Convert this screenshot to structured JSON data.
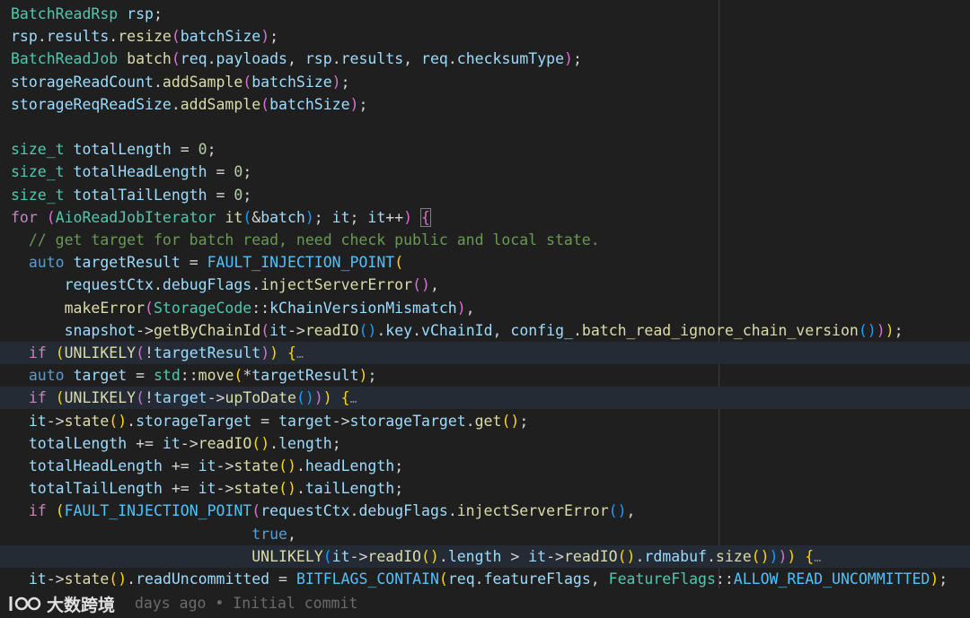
{
  "lines": [
    {
      "hl": false,
      "tokens": [
        {
          "t": "BatchReadRsp",
          "c": "t-type"
        },
        {
          "t": " ",
          "c": "t-plain"
        },
        {
          "t": "rsp",
          "c": "t-var"
        },
        {
          "t": ";",
          "c": "t-op"
        }
      ]
    },
    {
      "hl": false,
      "tokens": [
        {
          "t": "rsp",
          "c": "t-var"
        },
        {
          "t": ".",
          "c": "t-op"
        },
        {
          "t": "results",
          "c": "t-var"
        },
        {
          "t": ".",
          "c": "t-op"
        },
        {
          "t": "resize",
          "c": "t-fn"
        },
        {
          "t": "(",
          "c": "t-p2"
        },
        {
          "t": "batchSize",
          "c": "t-var"
        },
        {
          "t": ")",
          "c": "t-p2"
        },
        {
          "t": ";",
          "c": "t-op"
        }
      ]
    },
    {
      "hl": false,
      "tokens": [
        {
          "t": "BatchReadJob",
          "c": "t-type"
        },
        {
          "t": " ",
          "c": "t-plain"
        },
        {
          "t": "batch",
          "c": "t-fn"
        },
        {
          "t": "(",
          "c": "t-p2"
        },
        {
          "t": "req",
          "c": "t-var"
        },
        {
          "t": ".",
          "c": "t-op"
        },
        {
          "t": "payloads",
          "c": "t-var"
        },
        {
          "t": ", ",
          "c": "t-op"
        },
        {
          "t": "rsp",
          "c": "t-var"
        },
        {
          "t": ".",
          "c": "t-op"
        },
        {
          "t": "results",
          "c": "t-var"
        },
        {
          "t": ", ",
          "c": "t-op"
        },
        {
          "t": "req",
          "c": "t-var"
        },
        {
          "t": ".",
          "c": "t-op"
        },
        {
          "t": "checksumType",
          "c": "t-var"
        },
        {
          "t": ")",
          "c": "t-p2"
        },
        {
          "t": ";",
          "c": "t-op"
        }
      ]
    },
    {
      "hl": false,
      "tokens": [
        {
          "t": "storageReadCount",
          "c": "t-var"
        },
        {
          "t": ".",
          "c": "t-op"
        },
        {
          "t": "addSample",
          "c": "t-fn"
        },
        {
          "t": "(",
          "c": "t-p2"
        },
        {
          "t": "batchSize",
          "c": "t-var"
        },
        {
          "t": ")",
          "c": "t-p2"
        },
        {
          "t": ";",
          "c": "t-op"
        }
      ]
    },
    {
      "hl": false,
      "tokens": [
        {
          "t": "storageReqReadSize",
          "c": "t-var"
        },
        {
          "t": ".",
          "c": "t-op"
        },
        {
          "t": "addSample",
          "c": "t-fn"
        },
        {
          "t": "(",
          "c": "t-p2"
        },
        {
          "t": "batchSize",
          "c": "t-var"
        },
        {
          "t": ")",
          "c": "t-p2"
        },
        {
          "t": ";",
          "c": "t-op"
        }
      ]
    },
    {
      "hl": false,
      "tokens": []
    },
    {
      "hl": false,
      "tokens": [
        {
          "t": "size_t",
          "c": "t-type"
        },
        {
          "t": " ",
          "c": "t-plain"
        },
        {
          "t": "totalLength",
          "c": "t-var"
        },
        {
          "t": " = ",
          "c": "t-op"
        },
        {
          "t": "0",
          "c": "t-num"
        },
        {
          "t": ";",
          "c": "t-op"
        }
      ]
    },
    {
      "hl": false,
      "tokens": [
        {
          "t": "size_t",
          "c": "t-type"
        },
        {
          "t": " ",
          "c": "t-plain"
        },
        {
          "t": "totalHeadLength",
          "c": "t-var"
        },
        {
          "t": " = ",
          "c": "t-op"
        },
        {
          "t": "0",
          "c": "t-num"
        },
        {
          "t": ";",
          "c": "t-op"
        }
      ]
    },
    {
      "hl": false,
      "tokens": [
        {
          "t": "size_t",
          "c": "t-type"
        },
        {
          "t": " ",
          "c": "t-plain"
        },
        {
          "t": "totalTailLength",
          "c": "t-var"
        },
        {
          "t": " = ",
          "c": "t-op"
        },
        {
          "t": "0",
          "c": "t-num"
        },
        {
          "t": ";",
          "c": "t-op"
        }
      ]
    },
    {
      "hl": false,
      "tokens": [
        {
          "t": "for",
          "c": "t-ctrl"
        },
        {
          "t": " ",
          "c": "t-plain"
        },
        {
          "t": "(",
          "c": "t-p2"
        },
        {
          "t": "AioReadJobIterator",
          "c": "t-type"
        },
        {
          "t": " ",
          "c": "t-plain"
        },
        {
          "t": "it",
          "c": "t-fn"
        },
        {
          "t": "(",
          "c": "t-p3"
        },
        {
          "t": "&",
          "c": "t-op"
        },
        {
          "t": "batch",
          "c": "t-var"
        },
        {
          "t": ")",
          "c": "t-p3"
        },
        {
          "t": "; ",
          "c": "t-op"
        },
        {
          "t": "it",
          "c": "t-var"
        },
        {
          "t": "; ",
          "c": "t-op"
        },
        {
          "t": "it",
          "c": "t-var"
        },
        {
          "t": "++",
          "c": "t-op"
        },
        {
          "t": ")",
          "c": "t-p2"
        },
        {
          "t": " ",
          "c": "t-plain"
        },
        {
          "t": "{",
          "c": "t-p2",
          "box": true
        }
      ]
    },
    {
      "hl": false,
      "tokens": [
        {
          "t": "  ",
          "c": "t-plain"
        },
        {
          "t": "// get target for batch read, need check public and local state.",
          "c": "t-com"
        }
      ]
    },
    {
      "hl": false,
      "tokens": [
        {
          "t": "  ",
          "c": "t-plain"
        },
        {
          "t": "auto",
          "c": "t-kw"
        },
        {
          "t": " ",
          "c": "t-plain"
        },
        {
          "t": "targetResult",
          "c": "t-var"
        },
        {
          "t": " = ",
          "c": "t-op"
        },
        {
          "t": "FAULT_INJECTION_POINT",
          "c": "t-mac"
        },
        {
          "t": "(",
          "c": "t-p1"
        }
      ]
    },
    {
      "hl": false,
      "tokens": [
        {
          "t": "      ",
          "c": "t-plain"
        },
        {
          "t": "requestCtx",
          "c": "t-var"
        },
        {
          "t": ".",
          "c": "t-op"
        },
        {
          "t": "debugFlags",
          "c": "t-var"
        },
        {
          "t": ".",
          "c": "t-op"
        },
        {
          "t": "injectServerError",
          "c": "t-fn"
        },
        {
          "t": "()",
          "c": "t-p2"
        },
        {
          "t": ",",
          "c": "t-op"
        }
      ]
    },
    {
      "hl": false,
      "tokens": [
        {
          "t": "      ",
          "c": "t-plain"
        },
        {
          "t": "makeError",
          "c": "t-fn"
        },
        {
          "t": "(",
          "c": "t-p2"
        },
        {
          "t": "StorageCode",
          "c": "t-type"
        },
        {
          "t": "::",
          "c": "t-op"
        },
        {
          "t": "kChainVersionMismatch",
          "c": "t-var"
        },
        {
          "t": ")",
          "c": "t-p2"
        },
        {
          "t": ",",
          "c": "t-op"
        }
      ]
    },
    {
      "hl": false,
      "tokens": [
        {
          "t": "      ",
          "c": "t-plain"
        },
        {
          "t": "snapshot",
          "c": "t-var"
        },
        {
          "t": "->",
          "c": "t-op"
        },
        {
          "t": "getByChainId",
          "c": "t-fn"
        },
        {
          "t": "(",
          "c": "t-p2"
        },
        {
          "t": "it",
          "c": "t-var"
        },
        {
          "t": "->",
          "c": "t-op"
        },
        {
          "t": "readIO",
          "c": "t-fn"
        },
        {
          "t": "()",
          "c": "t-p3"
        },
        {
          "t": ".",
          "c": "t-op"
        },
        {
          "t": "key",
          "c": "t-var"
        },
        {
          "t": ".",
          "c": "t-op"
        },
        {
          "t": "vChainId",
          "c": "t-var"
        },
        {
          "t": ", ",
          "c": "t-op"
        },
        {
          "t": "config_",
          "c": "t-var"
        },
        {
          "t": ".",
          "c": "t-op"
        },
        {
          "t": "batch_read_ignore_chain_version",
          "c": "t-fn"
        },
        {
          "t": "()",
          "c": "t-p3"
        },
        {
          "t": ")",
          "c": "t-p2"
        },
        {
          "t": ")",
          "c": "t-p1"
        },
        {
          "t": ";",
          "c": "t-op"
        }
      ]
    },
    {
      "hl": true,
      "tokens": [
        {
          "t": "  ",
          "c": "t-plain"
        },
        {
          "t": "if",
          "c": "t-ctrl"
        },
        {
          "t": " ",
          "c": "t-plain"
        },
        {
          "t": "(",
          "c": "t-p1"
        },
        {
          "t": "UNLIKELY",
          "c": "t-fn"
        },
        {
          "t": "(",
          "c": "t-p2"
        },
        {
          "t": "!",
          "c": "t-op"
        },
        {
          "t": "targetResult",
          "c": "t-var"
        },
        {
          "t": ")",
          "c": "t-p2"
        },
        {
          "t": ")",
          "c": "t-p1"
        },
        {
          "t": " ",
          "c": "t-plain"
        },
        {
          "t": "{",
          "c": "t-p1"
        },
        {
          "t": "…",
          "c": "fold"
        }
      ]
    },
    {
      "hl": false,
      "tokens": [
        {
          "t": "  ",
          "c": "t-plain"
        },
        {
          "t": "auto",
          "c": "t-kw"
        },
        {
          "t": " ",
          "c": "t-plain"
        },
        {
          "t": "target",
          "c": "t-var"
        },
        {
          "t": " = ",
          "c": "t-op"
        },
        {
          "t": "std",
          "c": "t-type"
        },
        {
          "t": "::",
          "c": "t-op"
        },
        {
          "t": "move",
          "c": "t-fn"
        },
        {
          "t": "(",
          "c": "t-p1"
        },
        {
          "t": "*",
          "c": "t-op"
        },
        {
          "t": "targetResult",
          "c": "t-var"
        },
        {
          "t": ")",
          "c": "t-p1"
        },
        {
          "t": ";",
          "c": "t-op"
        }
      ]
    },
    {
      "hl": true,
      "tokens": [
        {
          "t": "  ",
          "c": "t-plain"
        },
        {
          "t": "if",
          "c": "t-ctrl"
        },
        {
          "t": " ",
          "c": "t-plain"
        },
        {
          "t": "(",
          "c": "t-p1"
        },
        {
          "t": "UNLIKELY",
          "c": "t-fn"
        },
        {
          "t": "(",
          "c": "t-p2"
        },
        {
          "t": "!",
          "c": "t-op"
        },
        {
          "t": "target",
          "c": "t-var"
        },
        {
          "t": "->",
          "c": "t-op"
        },
        {
          "t": "upToDate",
          "c": "t-fn"
        },
        {
          "t": "()",
          "c": "t-p3"
        },
        {
          "t": ")",
          "c": "t-p2"
        },
        {
          "t": ")",
          "c": "t-p1"
        },
        {
          "t": " ",
          "c": "t-plain"
        },
        {
          "t": "{",
          "c": "t-p1"
        },
        {
          "t": "…",
          "c": "fold"
        }
      ]
    },
    {
      "hl": false,
      "tokens": [
        {
          "t": "  ",
          "c": "t-plain"
        },
        {
          "t": "it",
          "c": "t-var"
        },
        {
          "t": "->",
          "c": "t-op"
        },
        {
          "t": "state",
          "c": "t-fn"
        },
        {
          "t": "()",
          "c": "t-p1"
        },
        {
          "t": ".",
          "c": "t-op"
        },
        {
          "t": "storageTarget",
          "c": "t-var"
        },
        {
          "t": " = ",
          "c": "t-op"
        },
        {
          "t": "target",
          "c": "t-var"
        },
        {
          "t": "->",
          "c": "t-op"
        },
        {
          "t": "storageTarget",
          "c": "t-var"
        },
        {
          "t": ".",
          "c": "t-op"
        },
        {
          "t": "get",
          "c": "t-fn"
        },
        {
          "t": "()",
          "c": "t-p1"
        },
        {
          "t": ";",
          "c": "t-op"
        }
      ]
    },
    {
      "hl": false,
      "tokens": [
        {
          "t": "  ",
          "c": "t-plain"
        },
        {
          "t": "totalLength",
          "c": "t-var"
        },
        {
          "t": " += ",
          "c": "t-op"
        },
        {
          "t": "it",
          "c": "t-var"
        },
        {
          "t": "->",
          "c": "t-op"
        },
        {
          "t": "readIO",
          "c": "t-fn"
        },
        {
          "t": "()",
          "c": "t-p1"
        },
        {
          "t": ".",
          "c": "t-op"
        },
        {
          "t": "length",
          "c": "t-var"
        },
        {
          "t": ";",
          "c": "t-op"
        }
      ]
    },
    {
      "hl": false,
      "tokens": [
        {
          "t": "  ",
          "c": "t-plain"
        },
        {
          "t": "totalHeadLength",
          "c": "t-var"
        },
        {
          "t": " += ",
          "c": "t-op"
        },
        {
          "t": "it",
          "c": "t-var"
        },
        {
          "t": "->",
          "c": "t-op"
        },
        {
          "t": "state",
          "c": "t-fn"
        },
        {
          "t": "()",
          "c": "t-p1"
        },
        {
          "t": ".",
          "c": "t-op"
        },
        {
          "t": "headLength",
          "c": "t-var"
        },
        {
          "t": ";",
          "c": "t-op"
        }
      ]
    },
    {
      "hl": false,
      "tokens": [
        {
          "t": "  ",
          "c": "t-plain"
        },
        {
          "t": "totalTailLength",
          "c": "t-var"
        },
        {
          "t": " += ",
          "c": "t-op"
        },
        {
          "t": "it",
          "c": "t-var"
        },
        {
          "t": "->",
          "c": "t-op"
        },
        {
          "t": "state",
          "c": "t-fn"
        },
        {
          "t": "()",
          "c": "t-p1"
        },
        {
          "t": ".",
          "c": "t-op"
        },
        {
          "t": "tailLength",
          "c": "t-var"
        },
        {
          "t": ";",
          "c": "t-op"
        }
      ]
    },
    {
      "hl": false,
      "tokens": [
        {
          "t": "  ",
          "c": "t-plain"
        },
        {
          "t": "if",
          "c": "t-ctrl"
        },
        {
          "t": " ",
          "c": "t-plain"
        },
        {
          "t": "(",
          "c": "t-p1"
        },
        {
          "t": "FAULT_INJECTION_POINT",
          "c": "t-mac"
        },
        {
          "t": "(",
          "c": "t-p2"
        },
        {
          "t": "requestCtx",
          "c": "t-var"
        },
        {
          "t": ".",
          "c": "t-op"
        },
        {
          "t": "debugFlags",
          "c": "t-var"
        },
        {
          "t": ".",
          "c": "t-op"
        },
        {
          "t": "injectServerError",
          "c": "t-fn"
        },
        {
          "t": "()",
          "c": "t-p3"
        },
        {
          "t": ",",
          "c": "t-op"
        }
      ]
    },
    {
      "hl": false,
      "tokens": [
        {
          "t": "                           ",
          "c": "t-plain"
        },
        {
          "t": "true",
          "c": "t-kw"
        },
        {
          "t": ",",
          "c": "t-op"
        }
      ]
    },
    {
      "hl": true,
      "tokens": [
        {
          "t": "                           ",
          "c": "t-plain"
        },
        {
          "t": "UNLIKELY",
          "c": "t-fn"
        },
        {
          "t": "(",
          "c": "t-p3"
        },
        {
          "t": "it",
          "c": "t-var"
        },
        {
          "t": "->",
          "c": "t-op"
        },
        {
          "t": "readIO",
          "c": "t-fn"
        },
        {
          "t": "()",
          "c": "t-p1"
        },
        {
          "t": ".",
          "c": "t-op"
        },
        {
          "t": "length",
          "c": "t-var"
        },
        {
          "t": " > ",
          "c": "t-op"
        },
        {
          "t": "it",
          "c": "t-var"
        },
        {
          "t": "->",
          "c": "t-op"
        },
        {
          "t": "readIO",
          "c": "t-fn"
        },
        {
          "t": "()",
          "c": "t-p1"
        },
        {
          "t": ".",
          "c": "t-op"
        },
        {
          "t": "rdmabuf",
          "c": "t-var"
        },
        {
          "t": ".",
          "c": "t-op"
        },
        {
          "t": "size",
          "c": "t-fn"
        },
        {
          "t": "()",
          "c": "t-p1"
        },
        {
          "t": ")",
          "c": "t-p3"
        },
        {
          "t": ")",
          "c": "t-p2"
        },
        {
          "t": ")",
          "c": "t-p1"
        },
        {
          "t": " ",
          "c": "t-plain"
        },
        {
          "t": "{",
          "c": "t-p1"
        },
        {
          "t": "…",
          "c": "fold"
        }
      ]
    },
    {
      "hl": false,
      "tokens": [
        {
          "t": "  ",
          "c": "t-plain"
        },
        {
          "t": "it",
          "c": "t-var"
        },
        {
          "t": "->",
          "c": "t-op"
        },
        {
          "t": "state",
          "c": "t-fn"
        },
        {
          "t": "()",
          "c": "t-p1"
        },
        {
          "t": ".",
          "c": "t-op"
        },
        {
          "t": "readUncommitted",
          "c": "t-var"
        },
        {
          "t": " = ",
          "c": "t-op"
        },
        {
          "t": "BITFLAGS_CONTAIN",
          "c": "t-mac"
        },
        {
          "t": "(",
          "c": "t-p1"
        },
        {
          "t": "req",
          "c": "t-var"
        },
        {
          "t": ".",
          "c": "t-op"
        },
        {
          "t": "featureFlags",
          "c": "t-var"
        },
        {
          "t": ", ",
          "c": "t-op"
        },
        {
          "t": "FeatureFlags",
          "c": "t-type"
        },
        {
          "t": "::",
          "c": "t-op"
        },
        {
          "t": "ALLOW_READ_UNCOMMITTED",
          "c": "t-const"
        },
        {
          "t": ")",
          "c": "t-p1"
        },
        {
          "t": ";",
          "c": "t-op"
        }
      ]
    }
  ],
  "blame": {
    "text": "days ago • Initial commit"
  },
  "watermark": {
    "brand": "大数跨境"
  }
}
